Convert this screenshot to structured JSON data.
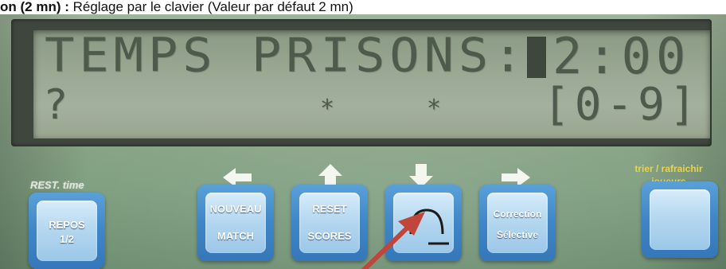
{
  "caption": {
    "bold": "on (2 mn) :",
    "text": " Réglage par le clavier (Valeur par défaut 2 mn)"
  },
  "lcd": {
    "line1": "TEMPS PRISONS:",
    "time": "2:00",
    "line2_left": "?",
    "star1": "*",
    "star2": "*",
    "range": "[0-9]"
  },
  "labels": {
    "rest": "REST. time",
    "trier_line1": "trier / rafraichir",
    "trier_line2": "joueurs"
  },
  "keys": {
    "repos": {
      "line1": "REPOS",
      "line2": "1/2"
    },
    "nouveau": {
      "line1": "NOUVEAU",
      "line2": "MATCH"
    },
    "reset": {
      "line1": "RESET",
      "line2": "SCORES"
    },
    "correction": {
      "line1": "Correction",
      "line2": "Sélective"
    }
  },
  "colors": {
    "panel": "#8fa98c",
    "lcd": "#9aa894",
    "key_blue": "#3f86c7",
    "yellow_label": "#e9d34a",
    "pointer_arrow": "#c0453a"
  },
  "icons": {
    "arrow_left": "arrow-left-icon",
    "arrow_up": "arrow-up-icon",
    "arrow_down": "arrow-down-icon",
    "arrow_right": "arrow-right-icon",
    "validate": "arc-validate-icon"
  }
}
